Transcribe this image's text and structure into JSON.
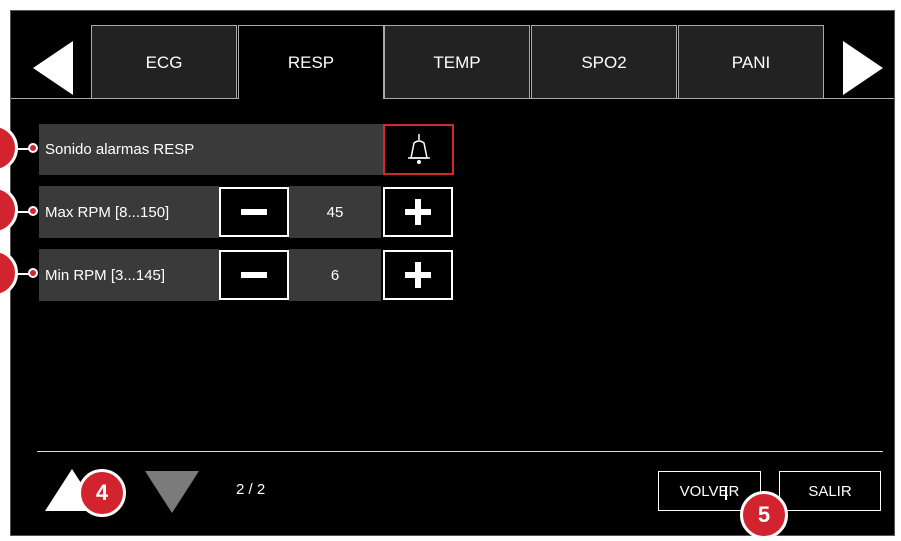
{
  "tabs": [
    {
      "label": "ECG",
      "active": false
    },
    {
      "label": "RESP",
      "active": true
    },
    {
      "label": "TEMP",
      "active": false
    },
    {
      "label": "SPO2",
      "active": false
    },
    {
      "label": "PANI",
      "active": false
    }
  ],
  "rows": {
    "alarm_sound": {
      "label": "Sonido alarmas RESP",
      "icon": "bell-icon"
    },
    "max_rpm": {
      "label": "Max RPM [8...150]",
      "value": "45"
    },
    "min_rpm": {
      "label": "Min RPM  [3...145]",
      "value": "6"
    }
  },
  "footer": {
    "page_indicator": "2 / 2",
    "back_label": "VOLVER",
    "exit_label": "SALIR"
  },
  "callouts": {
    "c4": "4",
    "c5": "5"
  },
  "colors": {
    "accent_red": "#d1242f",
    "background": "#000000",
    "panel": "#3a3a3a"
  }
}
